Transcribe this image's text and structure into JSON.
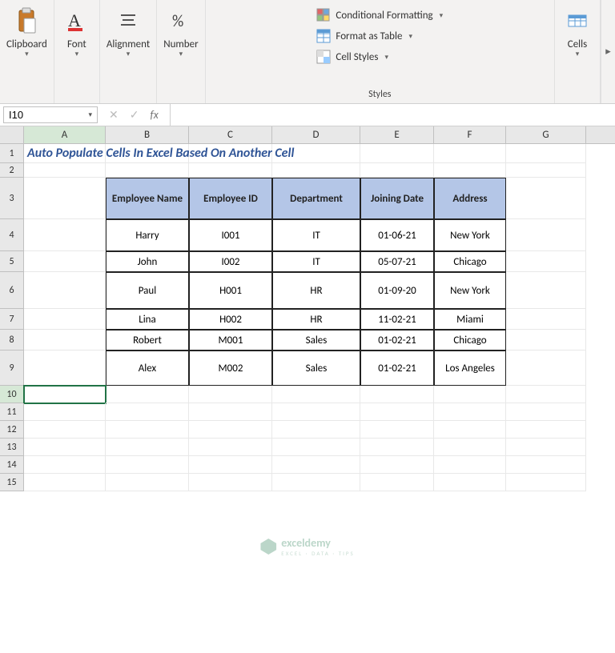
{
  "ribbon": {
    "clipboard": "Clipboard",
    "font": "Font",
    "alignment": "Alignment",
    "number": "Number",
    "styles_label": "Styles",
    "conditional_formatting": "Conditional Formatting",
    "format_as_table": "Format as Table",
    "cell_styles": "Cell Styles",
    "cells": "Cells"
  },
  "formula_bar": {
    "name_box": "I10",
    "fx": "fx",
    "formula": ""
  },
  "columns": [
    "A",
    "B",
    "C",
    "D",
    "E",
    "F",
    "G"
  ],
  "rows": [
    "1",
    "2",
    "3",
    "4",
    "5",
    "6",
    "7",
    "8",
    "9",
    "10",
    "11",
    "12",
    "13",
    "14",
    "15"
  ],
  "title": "Auto Populate Cells In Excel Based On Another Cell",
  "table_headers": [
    "Employee Name",
    "Employee ID",
    "Department",
    "Joining Date",
    "Address"
  ],
  "table_rows": [
    [
      "Harry",
      "I001",
      "IT",
      "01-06-21",
      "New York"
    ],
    [
      "John",
      "I002",
      "IT",
      "05-07-21",
      "Chicago"
    ],
    [
      "Paul",
      "H001",
      "HR",
      "01-09-20",
      "New York"
    ],
    [
      "Lina",
      "H002",
      "HR",
      "11-02-21",
      "Miami"
    ],
    [
      "Robert",
      "M001",
      "Sales",
      "01-02-21",
      "Chicago"
    ],
    [
      "Alex",
      "M002",
      "Sales",
      "01-02-21",
      "Los Angeles"
    ]
  ],
  "row_heights": {
    "1": 24,
    "2": 18,
    "3": 52,
    "4": 40,
    "5": 26,
    "6": 46,
    "7": 26,
    "8": 26,
    "9": 44,
    "10": 22,
    "11": 22,
    "12": 22,
    "13": 22,
    "14": 22,
    "15": 22
  },
  "active_cell": "A10",
  "watermark": {
    "brand": "exceldemy",
    "sub": "EXCEL · DATA · TIPS"
  }
}
